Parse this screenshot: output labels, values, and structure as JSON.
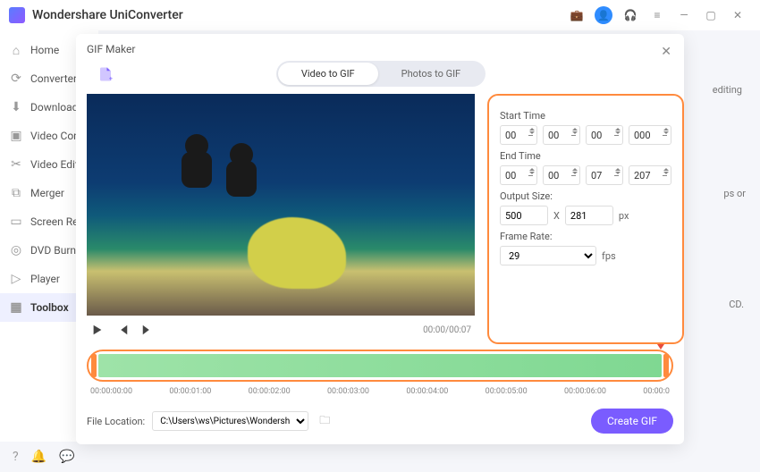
{
  "app": {
    "title": "Wondershare UniConverter"
  },
  "sidebar": {
    "items": [
      {
        "label": "Home"
      },
      {
        "label": "Converter"
      },
      {
        "label": "Downloader"
      },
      {
        "label": "Video Compressor"
      },
      {
        "label": "Video Editor"
      },
      {
        "label": "Merger"
      },
      {
        "label": "Screen Recorder"
      },
      {
        "label": "DVD Burner"
      },
      {
        "label": "Player"
      },
      {
        "label": "Toolbox"
      }
    ]
  },
  "dialog": {
    "title": "GIF Maker",
    "tabs": {
      "video": "Video to GIF",
      "photos": "Photos to GIF"
    },
    "player": {
      "time": "00:00/00:07"
    },
    "settings": {
      "startLabel": "Start Time",
      "start": {
        "h": "00",
        "m": "00",
        "s": "00",
        "ms": "000"
      },
      "endLabel": "End Time",
      "end": {
        "h": "00",
        "m": "00",
        "s": "07",
        "ms": "207"
      },
      "sizeLabel": "Output Size:",
      "size": {
        "w": "500",
        "h": "281"
      },
      "xLabel": "X",
      "pxLabel": "px",
      "frLabel": "Frame Rate:",
      "frameRate": "29",
      "fpsLabel": "fps"
    },
    "ticks": [
      "00:00:00:00",
      "00:00:01:00",
      "00:00:02:00",
      "00:00:03:00",
      "00:00:04:00",
      "00:00:05:00",
      "00:00:06:00",
      "00:00:0"
    ],
    "fileLocLabel": "File Location:",
    "fileLoc": "C:\\Users\\ws\\Pictures\\Wondersh",
    "createLabel": "Create GIF"
  },
  "bg": {
    "t1": "editing",
    "t2": "ps or",
    "t3": "CD."
  }
}
